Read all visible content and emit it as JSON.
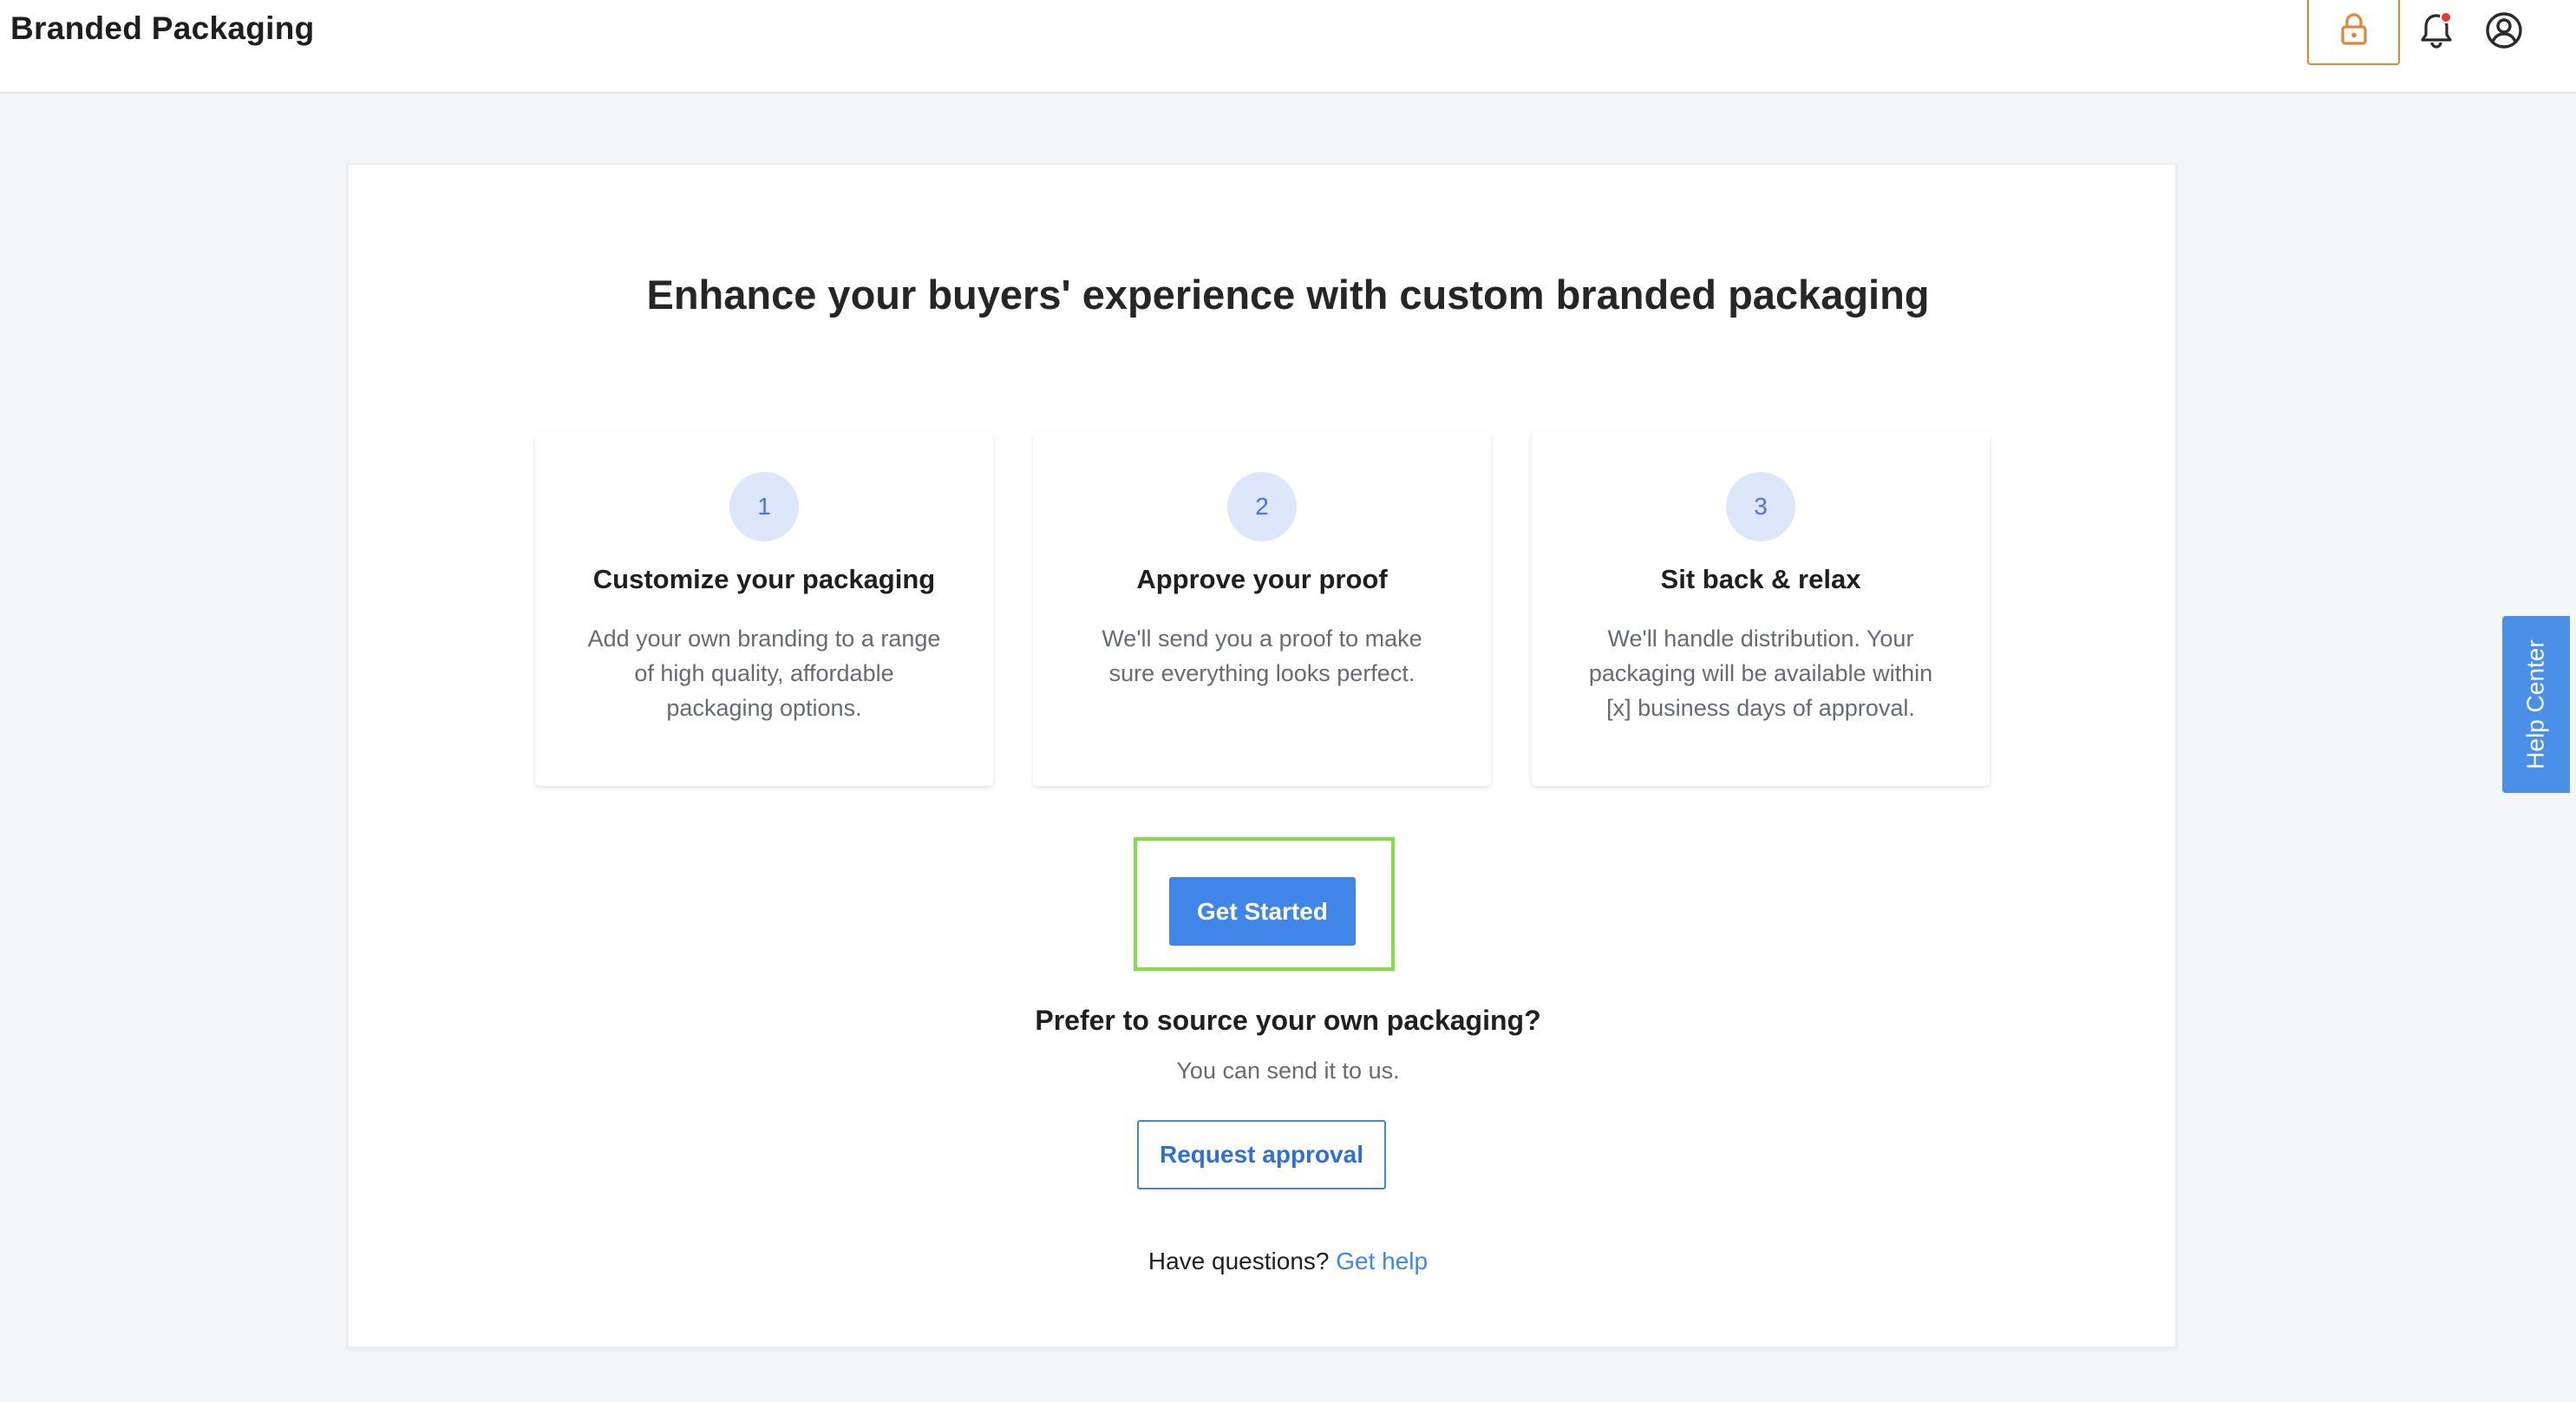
{
  "header": {
    "title": "Branded Packaging",
    "lock_icon": "lock-icon",
    "bell_icon": "bell-icon",
    "user_icon": "user-circle-icon"
  },
  "main": {
    "headline": "Enhance your buyers' experience with custom branded packaging",
    "steps": [
      {
        "number": "1",
        "title": "Customize your packaging",
        "description": "Add your own branding to a range of high quality, affordable packaging options."
      },
      {
        "number": "2",
        "title": "Approve your proof",
        "description": "We'll send you a proof to make sure everything looks perfect."
      },
      {
        "number": "3",
        "title": "Sit back & relax",
        "description": "We'll handle distribution. Your packaging will be available within [x] business days of approval."
      }
    ],
    "get_started_label": "Get Started",
    "prefer_heading": "Prefer to source your own packaging?",
    "prefer_sub": "You can send it to us.",
    "request_label": "Request approval",
    "questions_text": "Have questions? ",
    "help_link": "Get help"
  },
  "help_tab": {
    "label": "Help Center"
  },
  "colors": {
    "accent": "#3f86e8",
    "lock_accent": "#e0863a",
    "notification_dot": "#e53935",
    "step_circle": "#dde6fb",
    "focus_outline": "#7ee043"
  }
}
